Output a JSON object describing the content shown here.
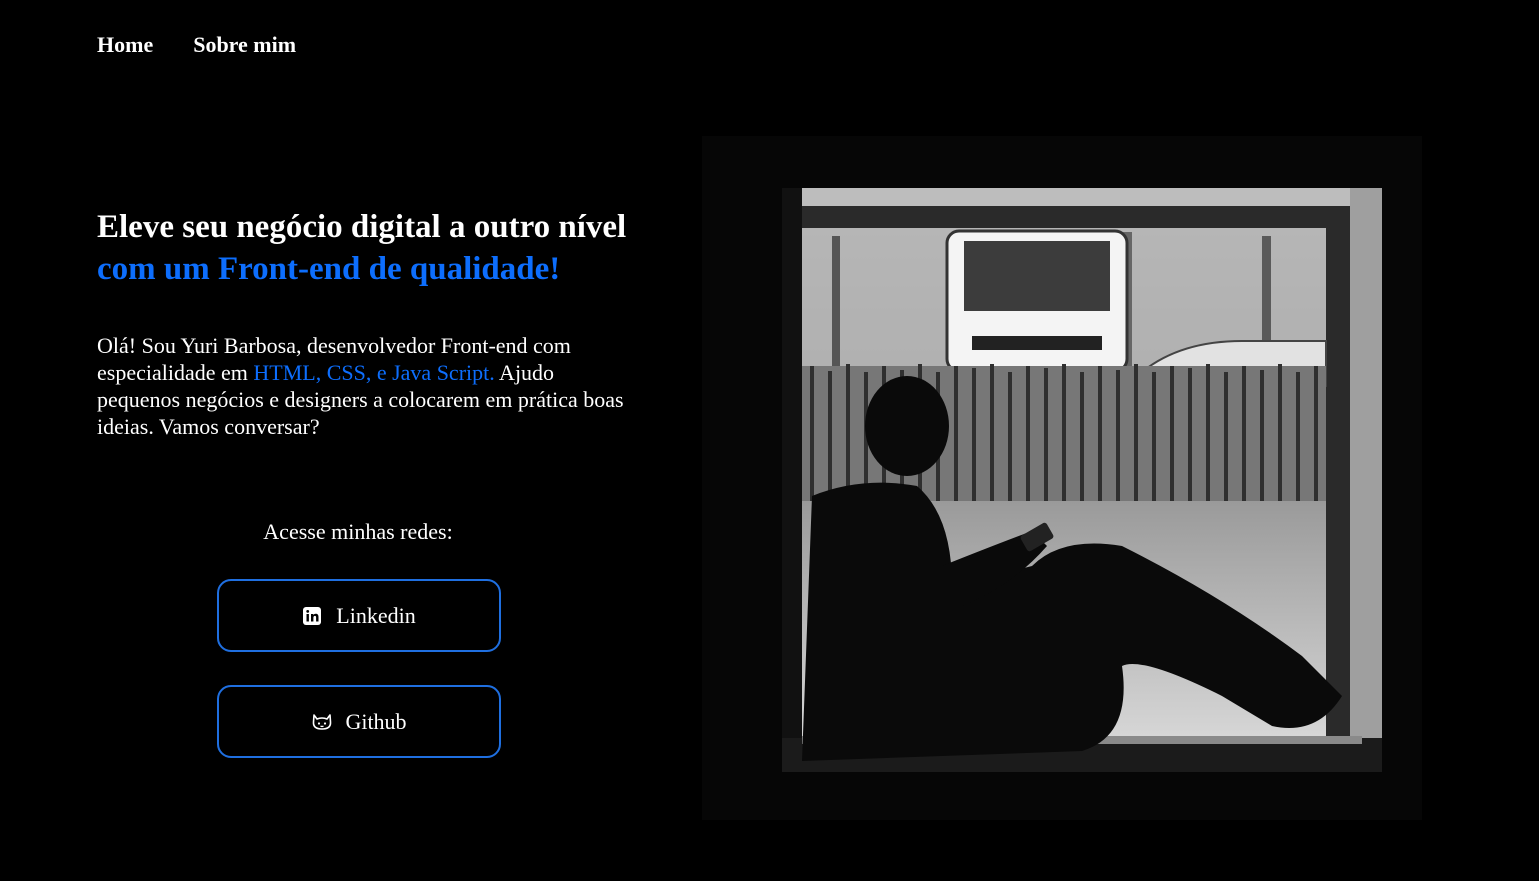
{
  "nav": {
    "home": "Home",
    "about": "Sobre mim"
  },
  "hero": {
    "headline_part1": "Eleve seu negócio digital a outro nível ",
    "headline_accent": "com um Front-end de qualidade!",
    "intro_part1": "Olá! Sou Yuri Barbosa, desenvolvedor Front-end com especialidade em ",
    "intro_accent": "HTML, CSS, e Java Script.",
    "intro_part2": " Ajudo pequenos negócios e designers a colocarem em prática boas ideias. Vamos conversar?"
  },
  "social": {
    "label": "Acesse minhas redes:",
    "linkedin": {
      "label": "Linkedin",
      "icon": "linkedin-icon"
    },
    "github": {
      "label": "Github",
      "icon": "github-icon"
    }
  },
  "colors": {
    "accent": "#0d6efd",
    "border": "#1f6fe0",
    "background": "#000000"
  }
}
